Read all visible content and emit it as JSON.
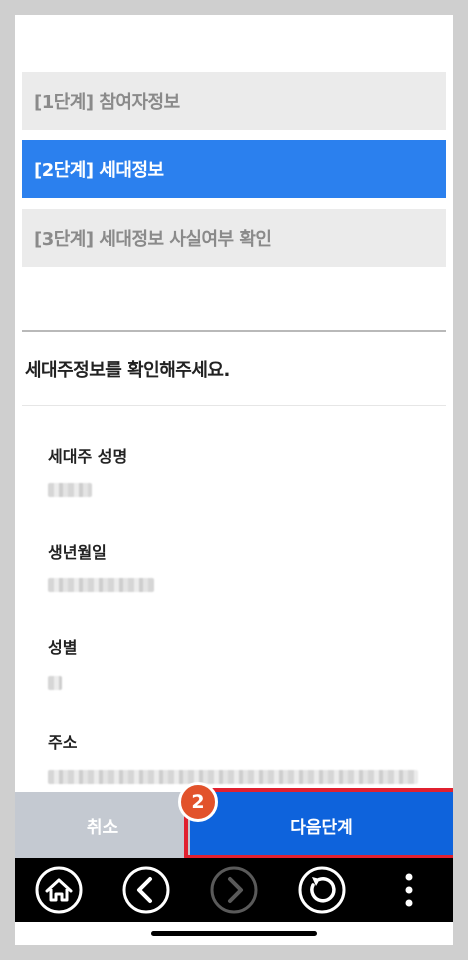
{
  "steps": [
    {
      "label": "[1단계] 참여자정보",
      "state": "inactive"
    },
    {
      "label": "[2단계] 세대정보",
      "state": "active"
    },
    {
      "label": "[3단계] 세대정보 사실여부 확인",
      "state": "inactive"
    }
  ],
  "section_title": "세대주정보를 확인해주세요.",
  "fields": [
    {
      "label": "세대주 성명"
    },
    {
      "label": "생년월일"
    },
    {
      "label": "성별"
    },
    {
      "label": "주소"
    }
  ],
  "buttons": {
    "cancel": "취소",
    "next": "다음단계"
  },
  "badge": "2",
  "nav_icons": [
    "home-icon",
    "back-icon",
    "forward-icon",
    "refresh-icon",
    "more-icon"
  ],
  "colors": {
    "active_step": "#2b80ee",
    "next_button": "#0e63dc",
    "cancel_button": "#c4c9d1",
    "highlight": "#e0202f",
    "badge": "#e2522b"
  }
}
